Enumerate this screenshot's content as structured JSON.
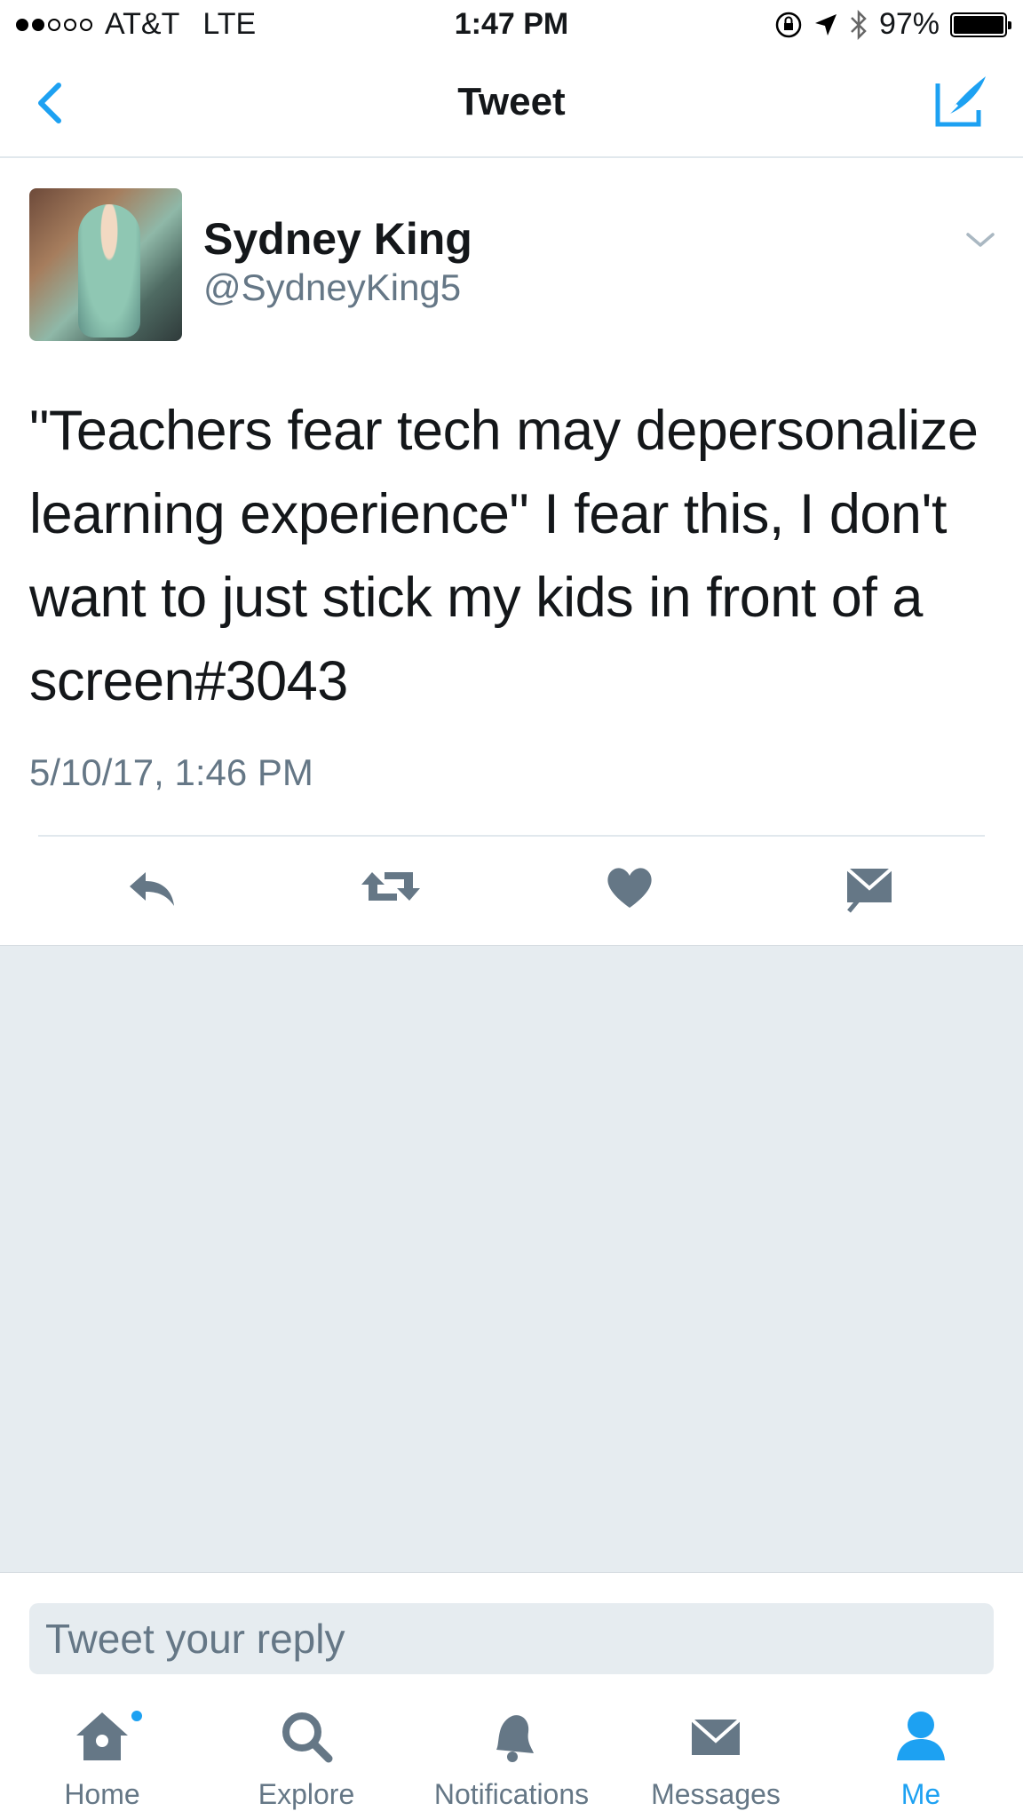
{
  "status_bar": {
    "carrier": "AT&T",
    "network": "LTE",
    "time": "1:47 PM",
    "battery": "97%",
    "signal_bars_filled": 2,
    "signal_bars_total": 5
  },
  "nav": {
    "title": "Tweet",
    "accent_color": "#1da1f2"
  },
  "tweet": {
    "author_name": "Sydney King",
    "author_handle": "@SydneyKing5",
    "text": "\"Teachers fear tech may depersonalize learning experience\" I fear this, I don't want to just stick my kids in front of a screen#3043",
    "timestamp": "5/10/17, 1:46 PM",
    "actions": [
      "reply-icon",
      "retweet-icon",
      "heart-icon",
      "envelope-icon"
    ]
  },
  "reply": {
    "placeholder": "Tweet your reply"
  },
  "tab_bar": {
    "tabs": [
      {
        "label": "Home",
        "icon": "home-icon"
      },
      {
        "label": "Explore",
        "icon": "search-icon"
      },
      {
        "label": "Notifications",
        "icon": "bell-icon"
      },
      {
        "label": "Messages",
        "icon": "envelope-icon"
      },
      {
        "label": "Me",
        "icon": "person-icon",
        "active": true
      }
    ]
  },
  "colors": {
    "accent": "#1da1f2",
    "secondary_text": "#657786",
    "background_gray": "#e6ecf0"
  }
}
